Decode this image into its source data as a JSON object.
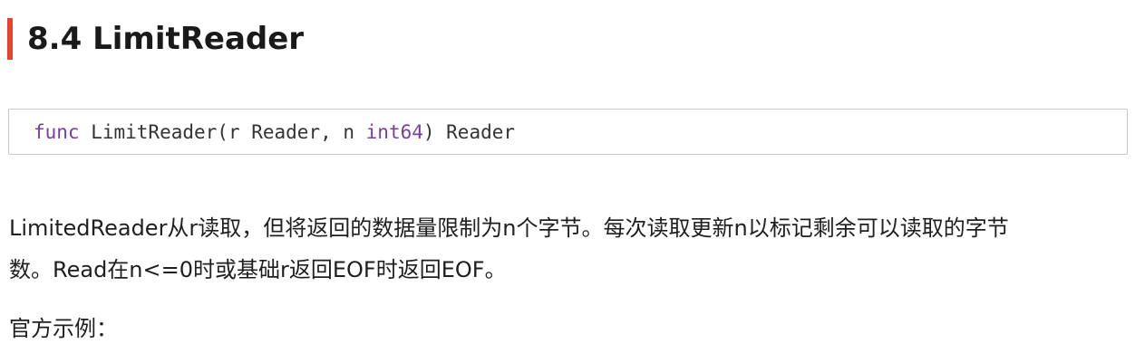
{
  "section": {
    "heading": "8.4 LimitReader",
    "accent_color": "#e8432e"
  },
  "code": {
    "keyword": "func",
    "before_type": " LimitReader(r Reader, n ",
    "type": "int64",
    "after_type": ") Reader",
    "keyword_color": "#7a3e9d"
  },
  "description": {
    "line1": "LimitedReader从r读取，但将返回的数据量限制为n个字节。每次读取更新n以标记剩余可以读取的字节",
    "line2": "数。Read在n<=0时或基础r返回EOF时返回EOF。"
  },
  "example_label": "官方示例："
}
